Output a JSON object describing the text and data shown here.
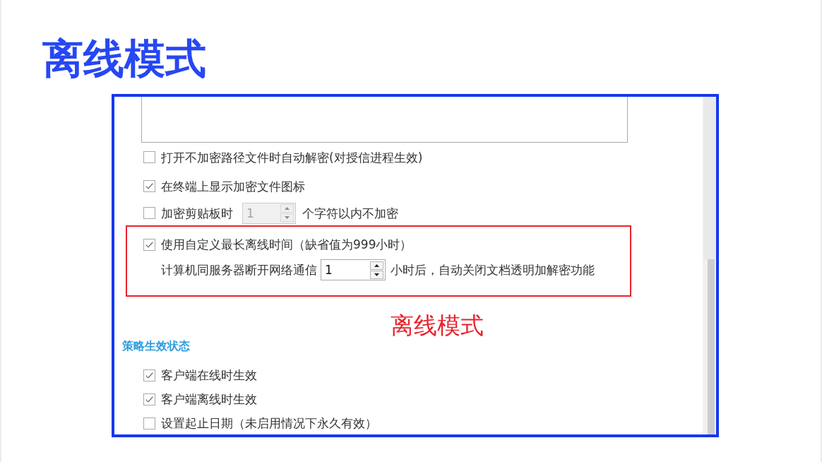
{
  "title": "离线模式",
  "panel": {
    "options": [
      {
        "kind": "checkbox",
        "label": "打开不加密路径文件时自动解密(对授信进程生效)",
        "checked": false
      },
      {
        "kind": "checkbox",
        "label": "在终端上显示加密文件图标",
        "checked": true
      },
      {
        "kind": "checkbox-spin",
        "label": "加密剪贴板时",
        "checked": false,
        "spin": {
          "value": "1",
          "disabled": true
        },
        "suffix": "个字符以内不加密"
      }
    ],
    "highlighted": {
      "option": {
        "label": "使用自定义最长离线时间（缺省值为999小时）",
        "checked": true
      },
      "detail": {
        "prefix": "计算机同服务器断开网络通信",
        "spin": {
          "value": "1",
          "disabled": false
        },
        "suffix": "小时后，自动关闭文档透明加解密功能"
      }
    },
    "section": {
      "title": "策略生效状态",
      "options": [
        {
          "kind": "checkbox",
          "label": "客户端在线时生效",
          "checked": true
        },
        {
          "kind": "checkbox",
          "label": "客户端离线时生效",
          "checked": true
        },
        {
          "kind": "checkbox",
          "label": "设置起止日期（未启用情况下永久有效）",
          "checked": false
        }
      ]
    }
  },
  "annotation": "离线模式"
}
